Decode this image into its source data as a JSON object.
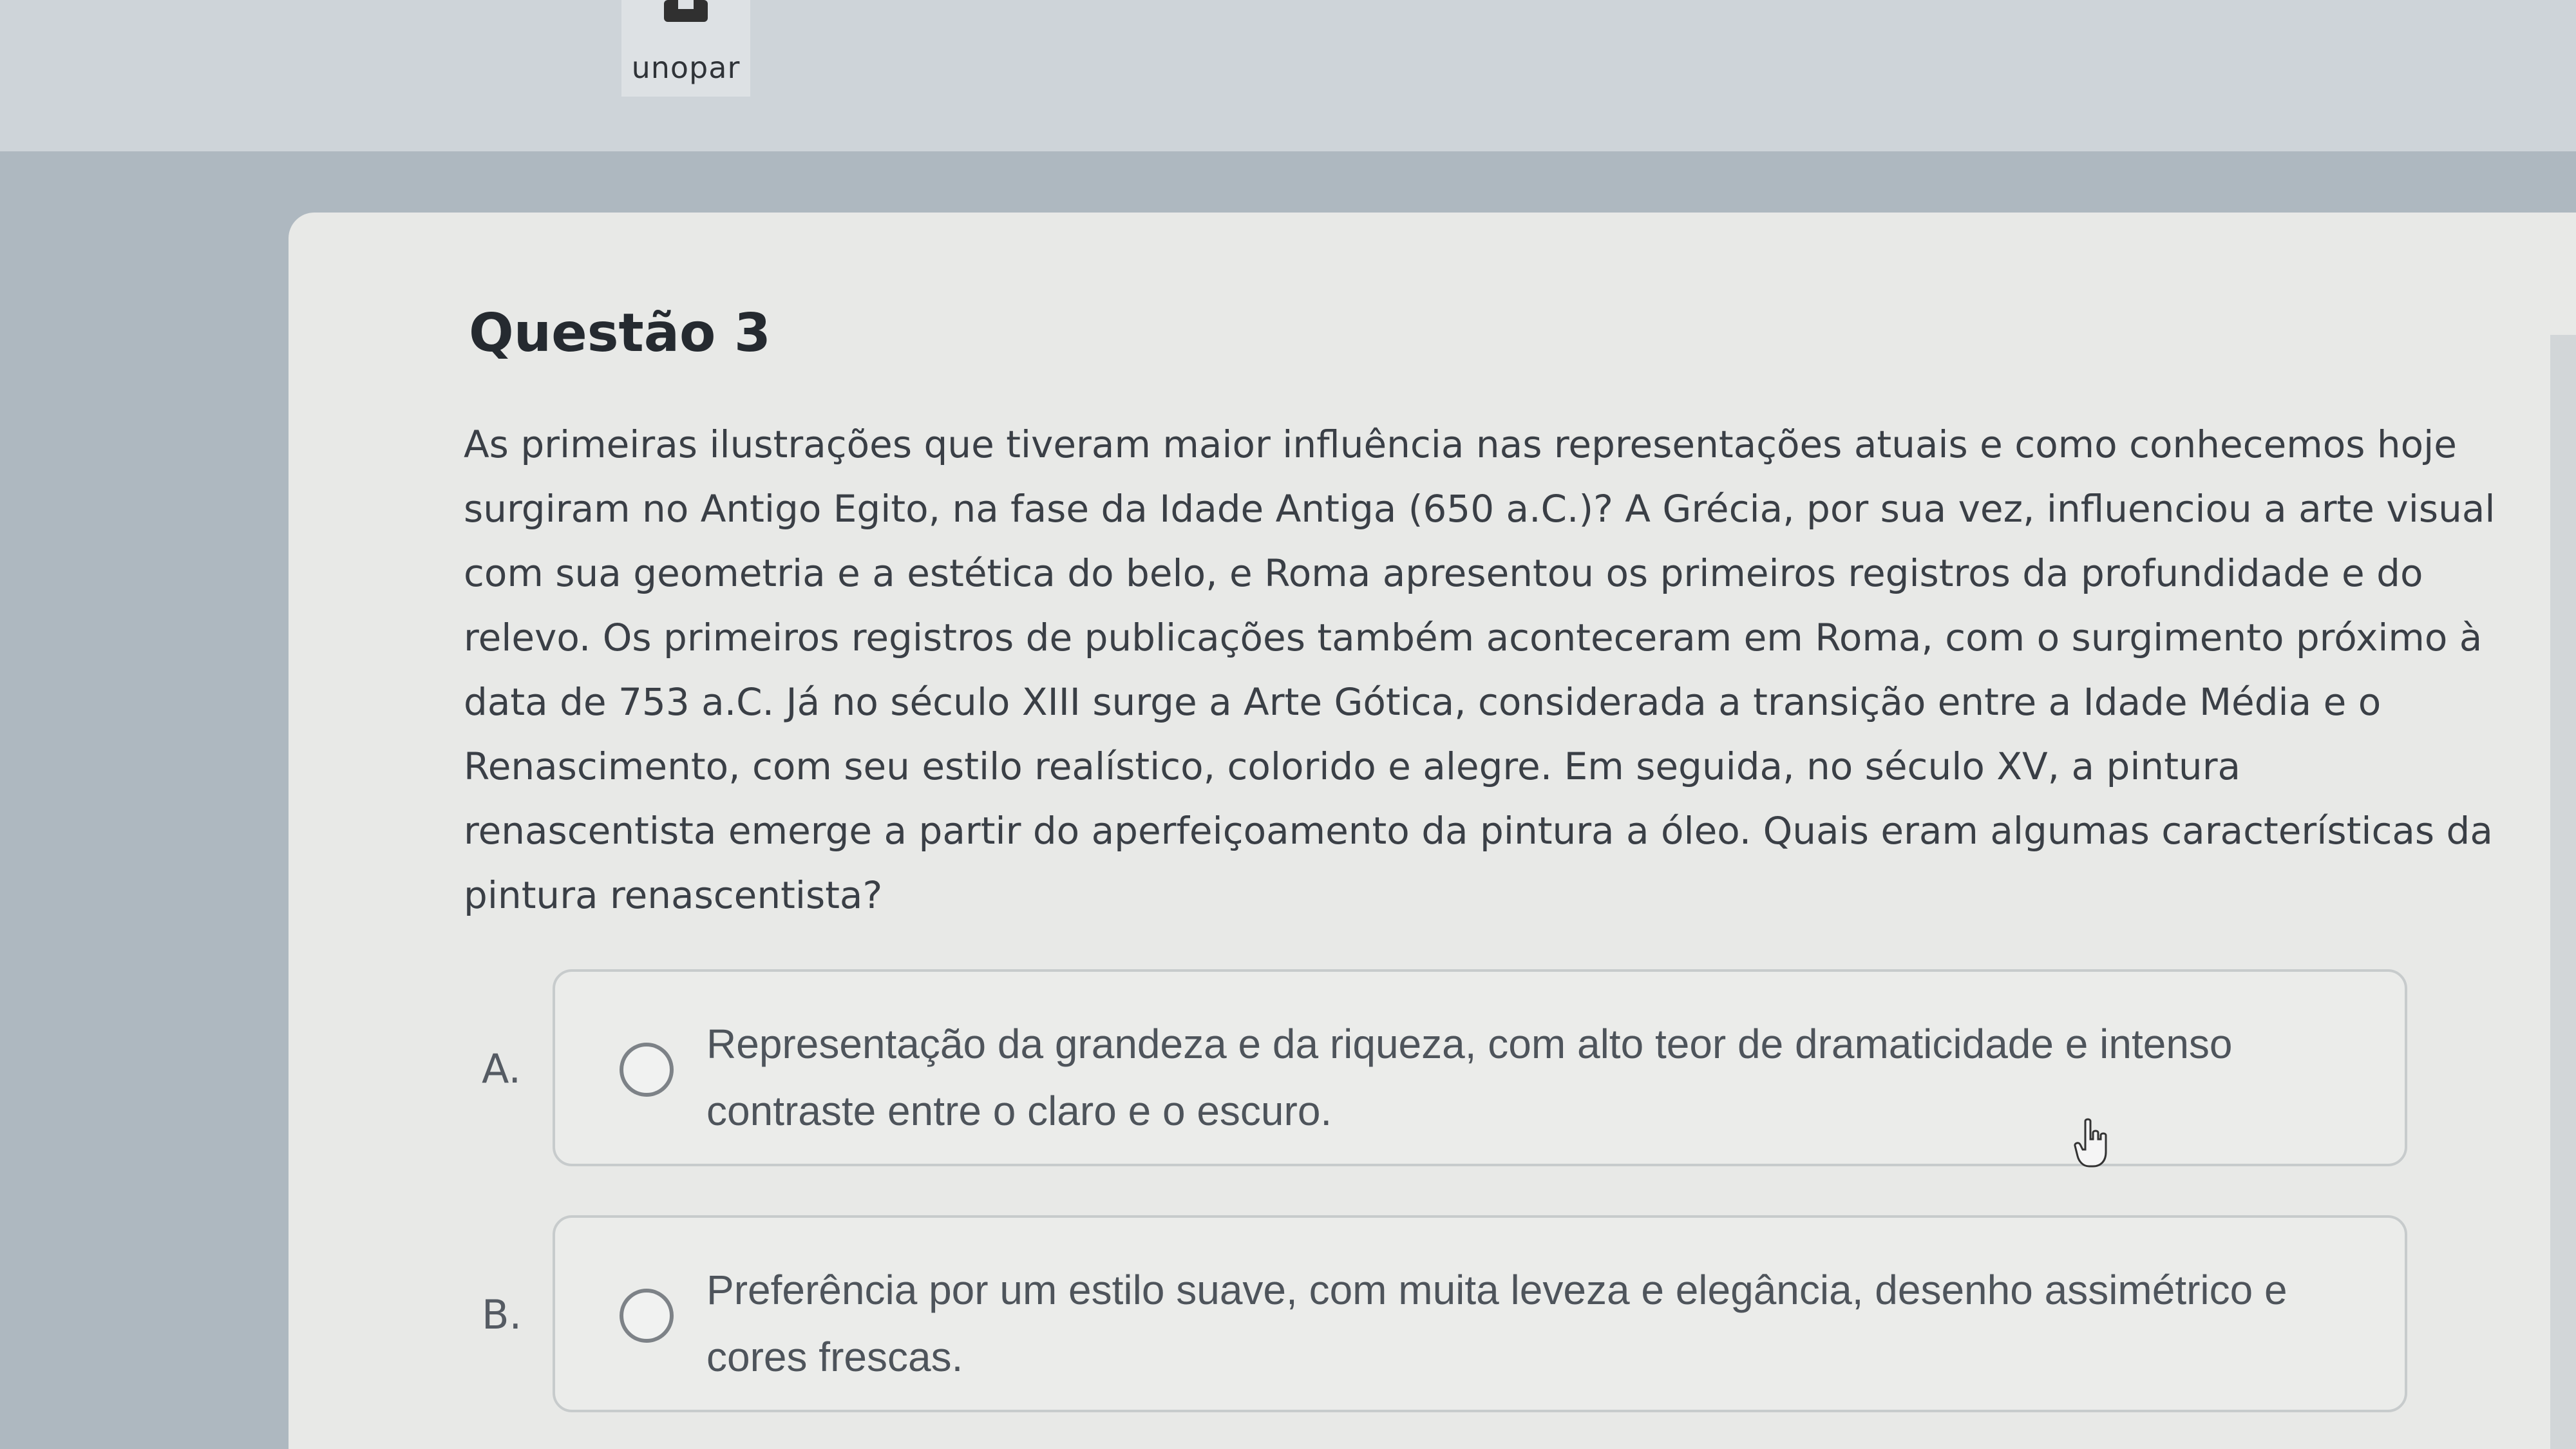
{
  "header": {
    "logo_text": "unopar",
    "logo_icon": "unopar-logo-icon"
  },
  "question": {
    "title": "Questão 3",
    "text": "As primeiras ilustrações que tiveram maior influência nas representações atuais e como conhecemos hoje surgiram no Antigo Egito, na fase da Idade Antiga (650 a.C.)? A Grécia, por sua vez, influenciou a arte visual com sua geometria e a estética do belo, e Roma apresentou os primeiros registros da profundidade e do relevo. Os primeiros registros de publicações também aconteceram em Roma, com o surgimento próximo à data de 753 a.C. Já no século XIII surge a Arte Gótica, considerada a transição entre a Idade Média e o Renascimento, com seu estilo realístico, colorido e alegre. Em seguida, no século XV, a pintura renascentista emerge a partir do aperfeiçoamento da pintura a óleo. Quais eram algumas características da pintura renascentista?"
  },
  "options": [
    {
      "letter": "A.",
      "text": "Representação da grandeza e da riqueza, com alto teor de dramaticidade e intenso contraste entre o claro e o escuro.",
      "selected": false
    },
    {
      "letter": "B.",
      "text": "Preferência por um estilo suave, com muita leveza e elegância, desenho assimétrico e cores frescas.",
      "selected": false
    }
  ],
  "cursor": {
    "icon": "hand-pointer-icon"
  },
  "colors": {
    "card_background": "#e8e9e7",
    "page_background": "#aeb8c0",
    "title_text": "#252a30",
    "body_text": "#3a3f46",
    "option_border": "#c7cbcc"
  }
}
